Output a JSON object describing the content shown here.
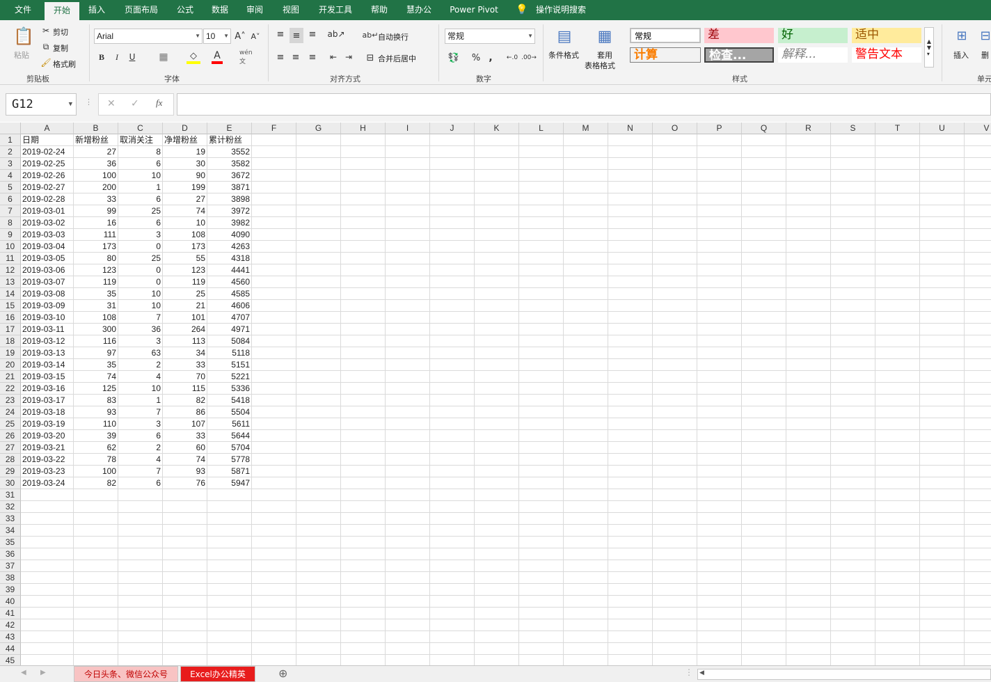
{
  "tabs": [
    "文件",
    "开始",
    "插入",
    "页面布局",
    "公式",
    "数据",
    "审阅",
    "视图",
    "开发工具",
    "帮助",
    "慧办公",
    "Power Pivot",
    "操作说明搜索"
  ],
  "clipboard": {
    "paste": "粘贴",
    "cut": "剪切",
    "copy": "复制",
    "format_painter": "格式刷",
    "label": "剪贴板"
  },
  "font": {
    "name": "Arial",
    "size": "10",
    "label": "字体",
    "bold": "B",
    "italic": "I",
    "underline": "U"
  },
  "alignment": {
    "wrap": "自动换行",
    "merge": "合并后居中",
    "label": "对齐方式"
  },
  "number": {
    "format": "常规",
    "label": "数字",
    "percent": "%",
    "comma": ","
  },
  "styles": {
    "cond_format": "条件格式",
    "table_format_1": "套用",
    "table_format_2": "表格格式",
    "label": "样式",
    "items": [
      {
        "text": "常规",
        "color": "#000000",
        "bg": "#ffffff"
      },
      {
        "text": "差",
        "color": "#9c0006",
        "bg": "#ffc7ce"
      },
      {
        "text": "好",
        "color": "#006100",
        "bg": "#c6efce"
      },
      {
        "text": "适中",
        "color": "#9c5700",
        "bg": "#ffeb9c"
      },
      {
        "text": "计算",
        "color": "#fa7d00",
        "bg": "#f2f2f2"
      },
      {
        "text": "检查...",
        "color": "#ffffff",
        "bg": "#a5a5a5"
      },
      {
        "text": "解释...",
        "color": "#7f7f7f",
        "bg": "#ffffff"
      },
      {
        "text": "警告文本",
        "color": "#ff0000",
        "bg": "#ffffff"
      }
    ]
  },
  "cells_group": {
    "insert": "插入",
    "delete": "删",
    "label": "单元"
  },
  "name_box": "G12",
  "columns": [
    "A",
    "B",
    "C",
    "D",
    "E",
    "F",
    "G",
    "H",
    "I",
    "J",
    "K",
    "L",
    "M",
    "N",
    "O",
    "P",
    "Q",
    "R",
    "S",
    "T",
    "U",
    "V"
  ],
  "headers": [
    "日期",
    "新增粉丝",
    "取消关注",
    "净增粉丝",
    "累计粉丝"
  ],
  "rows": [
    [
      "2019-02-24",
      "27",
      "8",
      "19",
      "3552"
    ],
    [
      "2019-02-25",
      "36",
      "6",
      "30",
      "3582"
    ],
    [
      "2019-02-26",
      "100",
      "10",
      "90",
      "3672"
    ],
    [
      "2019-02-27",
      "200",
      "1",
      "199",
      "3871"
    ],
    [
      "2019-02-28",
      "33",
      "6",
      "27",
      "3898"
    ],
    [
      "2019-03-01",
      "99",
      "25",
      "74",
      "3972"
    ],
    [
      "2019-03-02",
      "16",
      "6",
      "10",
      "3982"
    ],
    [
      "2019-03-03",
      "111",
      "3",
      "108",
      "4090"
    ],
    [
      "2019-03-04",
      "173",
      "0",
      "173",
      "4263"
    ],
    [
      "2019-03-05",
      "80",
      "25",
      "55",
      "4318"
    ],
    [
      "2019-03-06",
      "123",
      "0",
      "123",
      "4441"
    ],
    [
      "2019-03-07",
      "119",
      "0",
      "119",
      "4560"
    ],
    [
      "2019-03-08",
      "35",
      "10",
      "25",
      "4585"
    ],
    [
      "2019-03-09",
      "31",
      "10",
      "21",
      "4606"
    ],
    [
      "2019-03-10",
      "108",
      "7",
      "101",
      "4707"
    ],
    [
      "2019-03-11",
      "300",
      "36",
      "264",
      "4971"
    ],
    [
      "2019-03-12",
      "116",
      "3",
      "113",
      "5084"
    ],
    [
      "2019-03-13",
      "97",
      "63",
      "34",
      "5118"
    ],
    [
      "2019-03-14",
      "35",
      "2",
      "33",
      "5151"
    ],
    [
      "2019-03-15",
      "74",
      "4",
      "70",
      "5221"
    ],
    [
      "2019-03-16",
      "125",
      "10",
      "115",
      "5336"
    ],
    [
      "2019-03-17",
      "83",
      "1",
      "82",
      "5418"
    ],
    [
      "2019-03-18",
      "93",
      "7",
      "86",
      "5504"
    ],
    [
      "2019-03-19",
      "110",
      "3",
      "107",
      "5611"
    ],
    [
      "2019-03-20",
      "39",
      "6",
      "33",
      "5644"
    ],
    [
      "2019-03-21",
      "62",
      "2",
      "60",
      "5704"
    ],
    [
      "2019-03-22",
      "78",
      "4",
      "74",
      "5778"
    ],
    [
      "2019-03-23",
      "100",
      "7",
      "93",
      "5871"
    ],
    [
      "2019-03-24",
      "82",
      "6",
      "76",
      "5947"
    ]
  ],
  "sheets": [
    {
      "name": "今日头条、微信公众号",
      "active": false
    },
    {
      "name": "Excel办公精英",
      "active": true
    }
  ]
}
